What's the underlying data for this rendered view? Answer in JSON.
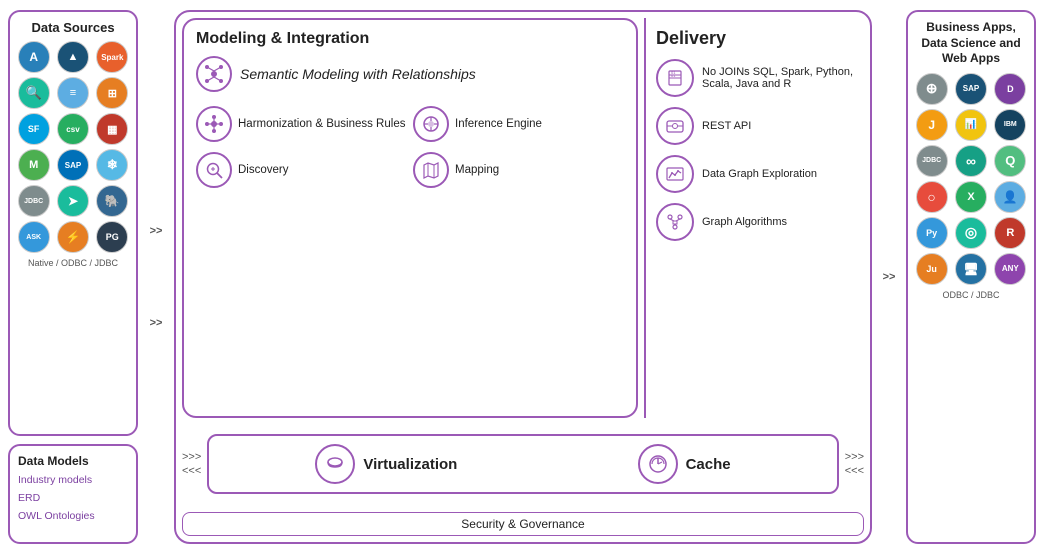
{
  "leftPanel": {
    "dataSources": {
      "title": "Data Sources",
      "nativeLabel": "Native / ODBC / JDBC",
      "icons": [
        {
          "name": "azure-icon",
          "letter": "A",
          "color": "ic-blue"
        },
        {
          "name": "atlas-icon",
          "letter": "▲",
          "color": "ic-blue2"
        },
        {
          "name": "spark-icon",
          "letter": "Sp",
          "color": "ic-orange"
        },
        {
          "name": "search-icon",
          "letter": "🔍",
          "color": "ic-teal"
        },
        {
          "name": "layers-icon",
          "letter": "≡",
          "color": "ic-lightblue"
        },
        {
          "name": "stack-icon",
          "letter": "⊞",
          "color": "ic-orange"
        },
        {
          "name": "salesforce-icon",
          "letter": "S",
          "color": "ic-blue"
        },
        {
          "name": "csv-icon",
          "letter": "CSV",
          "color": "ic-green"
        },
        {
          "name": "chart-icon",
          "letter": "▦",
          "color": "ic-red"
        },
        {
          "name": "mongodb-icon",
          "letter": "M",
          "color": "ic-green"
        },
        {
          "name": "sap-icon",
          "letter": "SAP",
          "color": "ic-blue"
        },
        {
          "name": "snowflake-icon",
          "letter": "❄",
          "color": "ic-lightblue"
        },
        {
          "name": "jdbc-icon",
          "letter": "JDBC",
          "color": "ic-gray"
        },
        {
          "name": "arrow-icon",
          "letter": "➤",
          "color": "ic-teal"
        },
        {
          "name": "postgres-icon",
          "letter": "🐘",
          "color": "ic-navy"
        },
        {
          "name": "ask-icon",
          "letter": "ASK",
          "color": "ic-blue"
        },
        {
          "name": "dynamo-icon",
          "letter": "⚡",
          "color": "ic-orange"
        },
        {
          "name": "postgre2-icon",
          "letter": "PG",
          "color": "ic-darkblue"
        }
      ]
    },
    "dataModels": {
      "title": "Data Models",
      "items": [
        "Industry models",
        "ERD",
        "OWL Ontologies"
      ]
    }
  },
  "centerPanel": {
    "modeling": {
      "title": "Modeling & Integration",
      "semanticTitle": "Semantic Modeling with Relationships",
      "features": [
        {
          "name": "harmonization",
          "label": "Harmonization & Business Rules"
        },
        {
          "name": "inference",
          "label": "Inference Engine"
        },
        {
          "name": "discovery",
          "label": "Discovery"
        },
        {
          "name": "mapping",
          "label": "Mapping"
        }
      ]
    },
    "delivery": {
      "title": "Delivery",
      "items": [
        {
          "name": "sql-item",
          "label": "No JOINs SQL, Spark, Python, Scala, Java and R"
        },
        {
          "name": "rest-item",
          "label": "REST API"
        },
        {
          "name": "graph-item",
          "label": "Data Graph Exploration"
        },
        {
          "name": "algo-item",
          "label": "Graph Algorithms"
        }
      ]
    },
    "bottom": {
      "arrows1": ">>>",
      "arrows2": "<<<",
      "virtualization": "Virtualization",
      "cache": "Cache",
      "security": "Security & Governance"
    }
  },
  "rightPanel": {
    "title": "Business Apps, Data Science and Web Apps",
    "jdbcLabel": "ODBC / JDBC",
    "icons": [
      {
        "name": "plus-icon",
        "letter": "⊕",
        "color": "ic-gray"
      },
      {
        "name": "sap-r-icon",
        "letter": "SAP",
        "color": "ic-blue2"
      },
      {
        "name": "domc-icon",
        "letter": "D",
        "color": "ic-purple"
      },
      {
        "name": "black-icon",
        "letter": "J",
        "color": "ic-amber"
      },
      {
        "name": "powerbi-icon",
        "letter": "📊",
        "color": "ic-yellow"
      },
      {
        "name": "cognos-icon",
        "letter": "IBM",
        "color": "ic-darkblue"
      },
      {
        "name": "jdbc2-icon",
        "letter": "JDBC",
        "color": "ic-gray"
      },
      {
        "name": "infinity-icon",
        "letter": "∞",
        "color": "ic-teal"
      },
      {
        "name": "qlik-icon",
        "letter": "Q",
        "color": "ic-green"
      },
      {
        "name": "circle-icon",
        "letter": "○",
        "color": "ic-red"
      },
      {
        "name": "excel-icon",
        "letter": "X",
        "color": "ic-green"
      },
      {
        "name": "person-icon",
        "letter": "👤",
        "color": "ic-lightblue"
      },
      {
        "name": "python-icon",
        "letter": "Py",
        "color": "ic-blue"
      },
      {
        "name": "obdc-icon",
        "letter": "◎",
        "color": "ic-teal"
      },
      {
        "name": "redis-icon",
        "letter": "R",
        "color": "ic-red"
      },
      {
        "name": "jupyter-icon",
        "letter": "Ju",
        "color": "ic-orange"
      },
      {
        "name": "display-icon",
        "letter": "🖥",
        "color": "ic-blue"
      },
      {
        "name": "any-icon",
        "letter": "ANY",
        "color": "ic-purple"
      }
    ]
  },
  "arrows": {
    "leftArrow": ">>",
    "rightArrow": ">>"
  }
}
